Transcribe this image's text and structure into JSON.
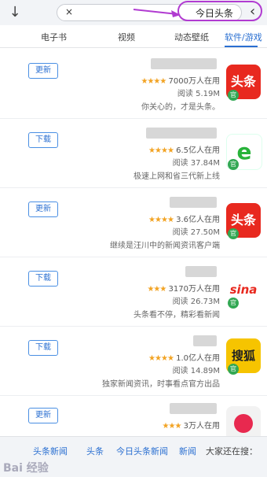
{
  "search": {
    "query": "今日头条",
    "clear": "×"
  },
  "tabs": [
    {
      "label": "软件/游戏",
      "active": true
    },
    {
      "label": "动态壁纸",
      "active": false
    },
    {
      "label": "视频",
      "active": false
    },
    {
      "label": "电子书",
      "active": false
    }
  ],
  "apps": [
    {
      "button": "更新",
      "rating": "★★★★",
      "users": "7000万人在用",
      "meta": "阅读 5.19M",
      "desc": "你关心的，才是头条。",
      "icon": "头条"
    },
    {
      "button": "下载",
      "rating": "★★★★",
      "users": "6.5亿人在用",
      "meta": "阅读 37.84M",
      "desc": "极速上网和省三代新上线",
      "icon": "e"
    },
    {
      "button": "更新",
      "rating": "★★★★",
      "users": "3.6亿人在用",
      "meta": "阅读 27.50M",
      "desc": "继续是汪川中的新闻资讯客户端",
      "icon": "头条"
    },
    {
      "button": "下载",
      "rating": "★★★",
      "users": "3170万人在用",
      "meta": "阅读 26.73M",
      "desc": "头条看不停，精彩看新闻",
      "icon": "sina"
    },
    {
      "button": "下载",
      "rating": "★★★★",
      "users": "1.0亿人在用",
      "meta": "阅读 14.89M",
      "desc": "独家新闻资讯，时事看点官方出品",
      "icon": "搜狐"
    },
    {
      "button": "更新",
      "rating": "★★★",
      "users": "3万人在用",
      "meta": "",
      "desc": "",
      "icon": ""
    }
  ],
  "bottom": {
    "title": "大家还在搜：",
    "keywords": [
      "新闻",
      "今日头条新闻",
      "头条",
      "头条新闻"
    ]
  },
  "watermark": "Bai 经验",
  "colors": {
    "accent": "#2a6fd1",
    "highlight": "#b13bd1",
    "star": "#f2a323"
  }
}
